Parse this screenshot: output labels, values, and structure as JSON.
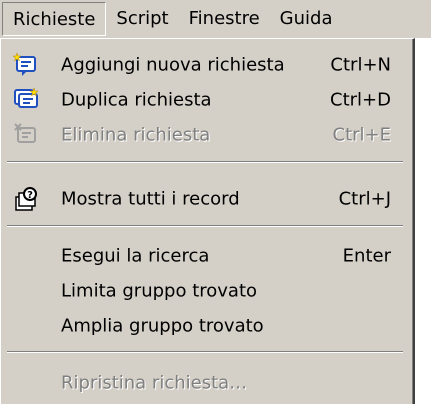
{
  "menubar": {
    "items": [
      {
        "label": "Richieste"
      },
      {
        "label": "Script"
      },
      {
        "label": "Finestre"
      },
      {
        "label": "Guida"
      }
    ]
  },
  "menu": {
    "items": [
      {
        "label": "Aggiungi nuova richiesta",
        "shortcut": "Ctrl+N",
        "icon": "add-request-icon",
        "enabled": true
      },
      {
        "label": "Duplica richiesta",
        "shortcut": "Ctrl+D",
        "icon": "duplicate-request-icon",
        "enabled": true
      },
      {
        "label": "Elimina richiesta",
        "shortcut": "Ctrl+E",
        "icon": "delete-request-icon",
        "enabled": false
      },
      {
        "label": "Mostra tutti i record",
        "shortcut": "Ctrl+J",
        "icon": "show-all-records-icon",
        "enabled": true
      },
      {
        "label": "Esegui la ricerca",
        "shortcut": "Enter",
        "enabled": true
      },
      {
        "label": "Limita gruppo trovato",
        "shortcut": "",
        "enabled": true
      },
      {
        "label": "Amplia gruppo trovato",
        "shortcut": "",
        "enabled": true
      },
      {
        "label": "Ripristina richiesta…",
        "shortcut": "",
        "enabled": false
      }
    ]
  },
  "colors": {
    "menu_bg": "#d4d0c8",
    "disabled_text": "#808080",
    "icon_blue": "#2050c0",
    "icon_yellow": "#ffe000"
  }
}
